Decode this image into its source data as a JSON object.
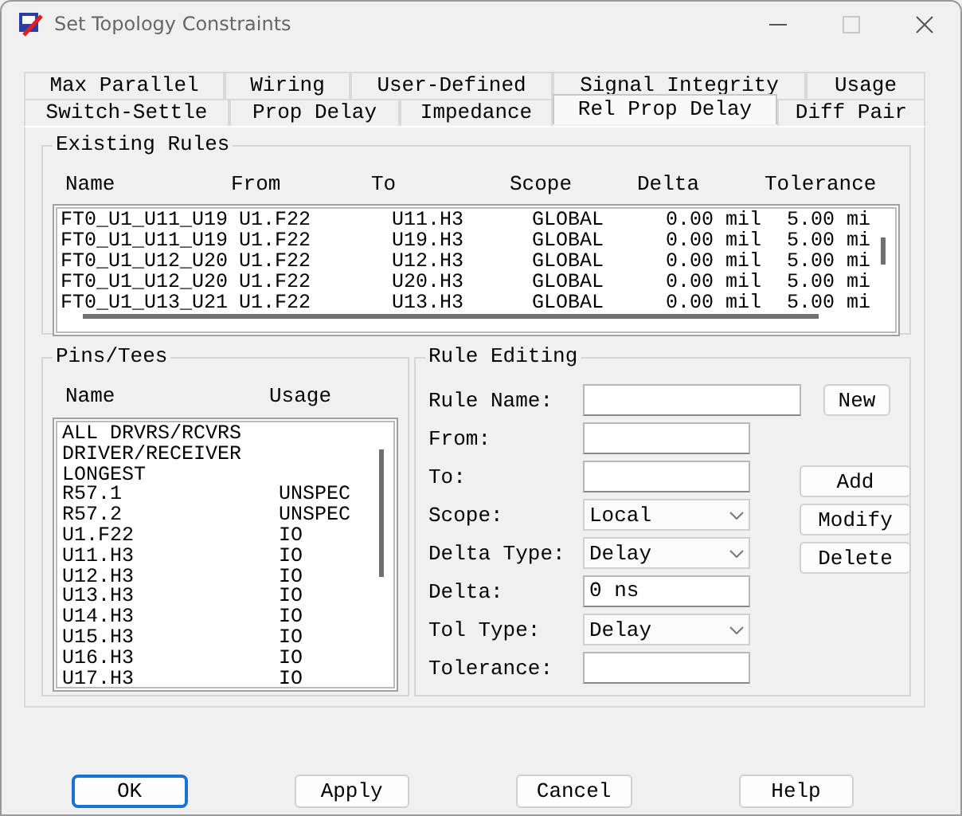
{
  "window": {
    "title": "Set Topology Constraints"
  },
  "tab_rows": [
    [
      {
        "label": "Max Parallel",
        "selected": false
      },
      {
        "label": "Wiring",
        "selected": false
      },
      {
        "label": "User-Defined",
        "selected": false
      },
      {
        "label": "Signal Integrity",
        "selected": false
      },
      {
        "label": "Usage",
        "selected": false
      }
    ],
    [
      {
        "label": "Switch-Settle",
        "selected": false
      },
      {
        "label": "Prop Delay",
        "selected": false
      },
      {
        "label": "Impedance",
        "selected": false
      },
      {
        "label": "Rel Prop Delay",
        "selected": true
      },
      {
        "label": "Diff Pair",
        "selected": false
      }
    ]
  ],
  "existing_rules": {
    "title": "Existing Rules",
    "columns": [
      "Name",
      "From",
      "To",
      "Scope",
      "Delta",
      "Tolerance"
    ],
    "rows": [
      [
        "FT0_U1_U11_U19",
        "U1.F22",
        "U11.H3",
        "GLOBAL",
        "0.00 mil",
        "5.00 mi"
      ],
      [
        "FT0_U1_U11_U19",
        "U1.F22",
        "U19.H3",
        "GLOBAL",
        "0.00 mil",
        "5.00 mi"
      ],
      [
        "FT0_U1_U12_U20",
        "U1.F22",
        "U12.H3",
        "GLOBAL",
        "0.00 mil",
        "5.00 mi"
      ],
      [
        "FT0_U1_U12_U20",
        "U1.F22",
        "U20.H3",
        "GLOBAL",
        "0.00 mil",
        "5.00 mi"
      ],
      [
        "FT0_U1_U13_U21",
        "U1.F22",
        "U13.H3",
        "GLOBAL",
        "0.00 mil",
        "5.00 mi"
      ]
    ]
  },
  "pins_tees": {
    "title": "Pins/Tees",
    "columns": [
      "Name",
      "Usage"
    ],
    "rows": [
      {
        "name": "ALL DRVRS/RCVRS"
      },
      {
        "name": "DRIVER/RECEIVER"
      },
      {
        "name": "LONGEST"
      },
      {
        "name": "R57.1",
        "usage": "UNSPEC"
      },
      {
        "name": "R57.2",
        "usage": "UNSPEC"
      },
      {
        "name": "U1.F22",
        "usage": "IO"
      },
      {
        "name": "U11.H3",
        "usage": "IO"
      },
      {
        "name": "U12.H3",
        "usage": "IO"
      },
      {
        "name": "U13.H3",
        "usage": "IO"
      },
      {
        "name": "U14.H3",
        "usage": "IO"
      },
      {
        "name": "U15.H3",
        "usage": "IO"
      },
      {
        "name": "U16.H3",
        "usage": "IO"
      },
      {
        "name": "U17.H3",
        "usage": "IO"
      }
    ]
  },
  "rule_editing": {
    "title": "Rule Editing",
    "new_button": "New",
    "fields": [
      {
        "label": "Rule Name:",
        "kind": "text"
      },
      {
        "label": "From:",
        "kind": "text"
      },
      {
        "label": "To:",
        "kind": "text"
      },
      {
        "label": "Scope:",
        "kind": "select",
        "value": "Local"
      },
      {
        "label": "Delta Type:",
        "kind": "select",
        "value": "Delay"
      },
      {
        "label": "Delta:",
        "kind": "text",
        "value": "0 ns"
      },
      {
        "label": "Tol Type:",
        "kind": "select",
        "value": "Delay"
      },
      {
        "label": "Tolerance:",
        "kind": "text"
      }
    ],
    "buttons": [
      "Add",
      "Modify",
      "Delete"
    ]
  },
  "dialog_buttons": [
    {
      "label": "OK",
      "default": true
    },
    {
      "label": "Apply",
      "default": false
    },
    {
      "label": "Cancel",
      "default": false
    },
    {
      "label": "Help",
      "default": false
    }
  ]
}
